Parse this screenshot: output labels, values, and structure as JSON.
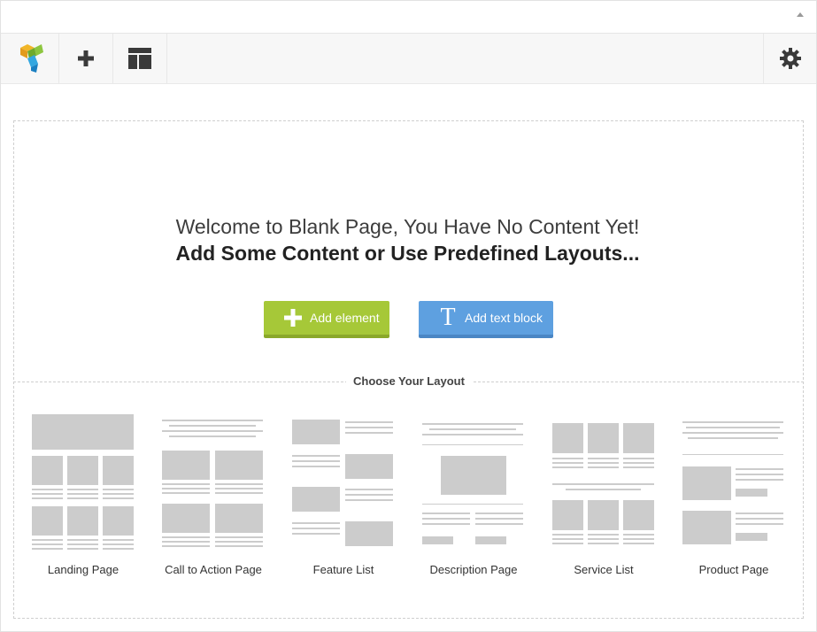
{
  "toolbar": {
    "logo_icon": "visual-composer-logo-icon",
    "add_icon": "plus-icon",
    "templates_icon": "layout-templates-icon",
    "settings_icon": "gear-icon"
  },
  "main": {
    "welcome": "Welcome to Blank Page, You Have No Content Yet!",
    "subtitle": "Add Some Content or Use Predefined Layouts...",
    "add_element_label": "Add element",
    "add_text_block_label": "Add text block",
    "add_text_block_glyph": "T"
  },
  "layouts": {
    "heading": "Choose Your Layout",
    "items": [
      {
        "label": "Landing Page"
      },
      {
        "label": "Call to Action Page"
      },
      {
        "label": "Feature List"
      },
      {
        "label": "Description Page"
      },
      {
        "label": "Service List"
      },
      {
        "label": "Product Page"
      }
    ]
  },
  "colors": {
    "green": "#a6c838",
    "blue": "#5ea0e0",
    "thumb": "#cccccc"
  }
}
